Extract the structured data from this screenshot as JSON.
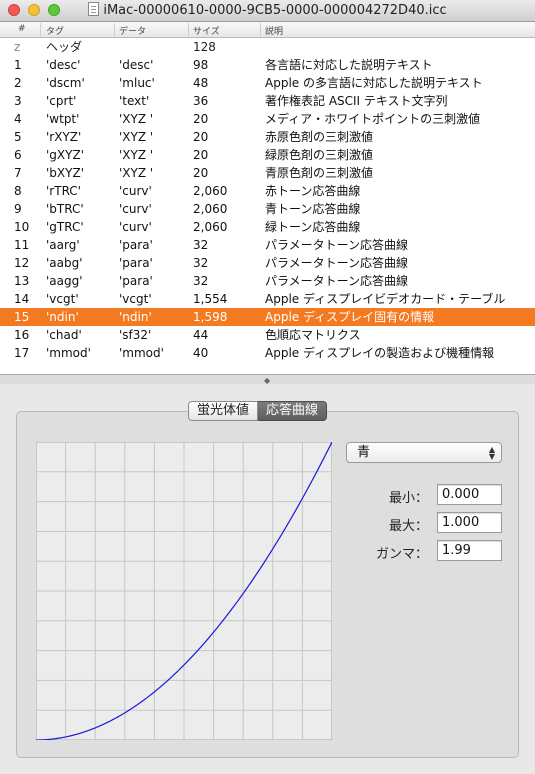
{
  "window": {
    "title": "iMac-00000610-0000-9CB5-0000-000004272D40.icc"
  },
  "table": {
    "headers": {
      "num": "#",
      "tag": "タグ",
      "data": "データ",
      "size": "サイズ",
      "desc": "説明"
    },
    "header_row": {
      "num": "z",
      "tag": "ヘッダ",
      "data": "",
      "size": "128",
      "desc": ""
    },
    "rows": [
      {
        "num": "1",
        "tag": "'desc'",
        "data": "'desc'",
        "size": "98",
        "desc": "各言語に対応した説明テキスト"
      },
      {
        "num": "2",
        "tag": "'dscm'",
        "data": "'mluc'",
        "size": "48",
        "desc": "Apple の多言語に対応した説明テキスト"
      },
      {
        "num": "3",
        "tag": "'cprt'",
        "data": "'text'",
        "size": "36",
        "desc": "著作権表記 ASCII テキスト文字列"
      },
      {
        "num": "4",
        "tag": "'wtpt'",
        "data": "'XYZ '",
        "size": "20",
        "desc": "メディア・ホワイトポイントの三刺激値"
      },
      {
        "num": "5",
        "tag": "'rXYZ'",
        "data": "'XYZ '",
        "size": "20",
        "desc": "赤原色剤の三刺激値"
      },
      {
        "num": "6",
        "tag": "'gXYZ'",
        "data": "'XYZ '",
        "size": "20",
        "desc": "緑原色剤の三刺激値"
      },
      {
        "num": "7",
        "tag": "'bXYZ'",
        "data": "'XYZ '",
        "size": "20",
        "desc": "青原色剤の三刺激値"
      },
      {
        "num": "8",
        "tag": "'rTRC'",
        "data": "'curv'",
        "size": "2,060",
        "desc": "赤トーン応答曲線"
      },
      {
        "num": "9",
        "tag": "'bTRC'",
        "data": "'curv'",
        "size": "2,060",
        "desc": "青トーン応答曲線"
      },
      {
        "num": "10",
        "tag": "'gTRC'",
        "data": "'curv'",
        "size": "2,060",
        "desc": "緑トーン応答曲線"
      },
      {
        "num": "11",
        "tag": "'aarg'",
        "data": "'para'",
        "size": "32",
        "desc": "パラメータトーン応答曲線"
      },
      {
        "num": "12",
        "tag": "'aabg'",
        "data": "'para'",
        "size": "32",
        "desc": "パラメータトーン応答曲線"
      },
      {
        "num": "13",
        "tag": "'aagg'",
        "data": "'para'",
        "size": "32",
        "desc": "パラメータトーン応答曲線"
      },
      {
        "num": "14",
        "tag": "'vcgt'",
        "data": "'vcgt'",
        "size": "1,554",
        "desc": "Apple ディスプレイビデオカード・テーブル"
      },
      {
        "num": "15",
        "tag": "'ndin'",
        "data": "'ndin'",
        "size": "1,598",
        "desc": "Apple ディスプレイ固有の情報"
      },
      {
        "num": "16",
        "tag": "'chad'",
        "data": "'sf32'",
        "size": "44",
        "desc": "色順応マトリクス"
      },
      {
        "num": "17",
        "tag": "'mmod'",
        "data": "'mmod'",
        "size": "40",
        "desc": "Apple ディスプレイの製造および機種情報"
      }
    ],
    "selected_num": "15"
  },
  "tabs": [
    {
      "label": "蛍光体値",
      "active": false
    },
    {
      "label": "応答曲線",
      "active": true
    }
  ],
  "curve": {
    "channel": "青",
    "min_label": "最小：",
    "min_value": "0.000",
    "max_label": "最大：",
    "max_value": "1.000",
    "gamma_label": "ガンマ：",
    "gamma_value": "1.99",
    "gamma": 1.99,
    "min": 0.0,
    "max": 1.0,
    "line_color": "#1a1ad8",
    "grid_color": "#c6c6c6",
    "bg_color": "#ececec"
  },
  "colors": {
    "selection": "#f47a22"
  }
}
